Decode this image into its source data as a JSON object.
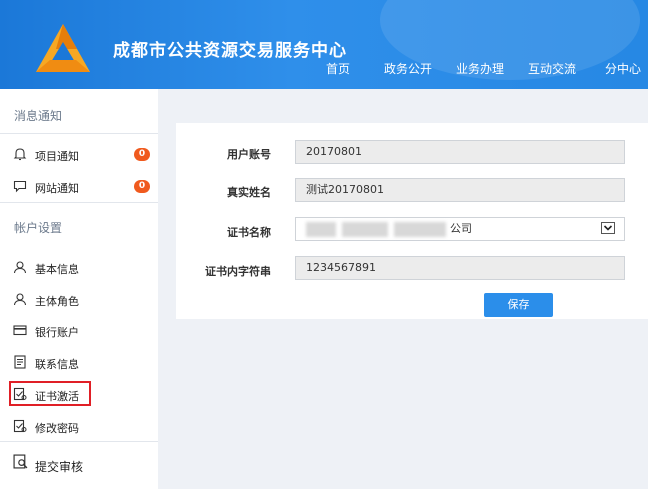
{
  "header": {
    "site_title": "成都市公共资源交易服务中心",
    "nav": [
      "首页",
      "政务公开",
      "业务办理",
      "互动交流",
      "分中心"
    ]
  },
  "sidebar": {
    "section1_title": "消息通知",
    "notify_items": [
      {
        "label": "项目通知",
        "badge": "0",
        "icon": "bell-icon"
      },
      {
        "label": "网站通知",
        "badge": "0",
        "icon": "message-icon"
      }
    ],
    "section2_title": "帐户设置",
    "account_items": [
      {
        "label": "基本信息",
        "icon": "user-icon"
      },
      {
        "label": "主体角色",
        "icon": "user-icon"
      },
      {
        "label": "银行账户",
        "icon": "card-icon"
      },
      {
        "label": "联系信息",
        "icon": "document-icon"
      },
      {
        "label": "证书激活",
        "icon": "certificate-icon"
      },
      {
        "label": "修改密码",
        "icon": "certificate-icon"
      }
    ],
    "submit_label": "提交审核"
  },
  "form": {
    "account_label": "用户账号",
    "account_value": "20170801",
    "name_label": "真实姓名",
    "name_value": "测试20170801",
    "cert_name_label": "证书名称",
    "cert_name_visible": "公司",
    "cert_code_label": "证书内字符串",
    "cert_code_value": "1234567891",
    "save_label": "保存"
  },
  "colors": {
    "header_blue": "#2688e4",
    "badge_orange": "#f05a1e",
    "highlight_red": "#e01f26",
    "button_blue": "#2b8eea"
  }
}
